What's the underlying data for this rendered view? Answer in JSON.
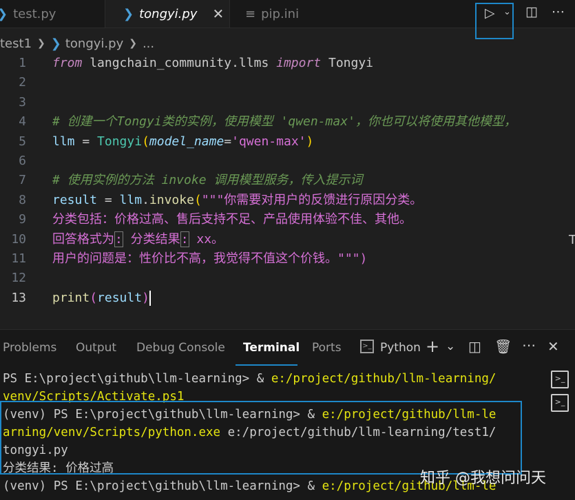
{
  "tabs": [
    {
      "label": "test.py",
      "active": false
    },
    {
      "label": "tongyi.py",
      "active": true
    },
    {
      "label": "pip.ini",
      "active": false
    }
  ],
  "tab_close_glyph": "✕",
  "breadcrumb": {
    "folder": "test1",
    "file": "tongyi.py",
    "more": "..."
  },
  "line_numbers": [
    "1",
    "2",
    "3",
    "4",
    "5",
    "6",
    "7",
    "8",
    "9",
    "10",
    "11",
    "12",
    "13"
  ],
  "code": {
    "l1": {
      "kw_from": "from",
      "module": " langchain_community.llms ",
      "kw_import": "import",
      "cls": " Tongyi"
    },
    "l4": "# 创建一个Tongyi类的实例，使用模型 'qwen-max'，你也可以将使用其他模型，",
    "l5": {
      "var": "llm",
      "eq": " = ",
      "cls": "Tongyi",
      "open": "(",
      "param": "model_name",
      "assign": "=",
      "str": "'qwen-max'",
      "close": ")"
    },
    "l7": "# 使用实例的方法 invoke 调用模型服务，传入提示词",
    "l8": {
      "var": "result",
      "eq": " = ",
      "obj": "llm",
      "dot": ".",
      "fn": "invoke",
      "open": "(",
      "str": "\"\"\"你需要对用户的反馈进行原因分类。"
    },
    "l9": "分类包括：价格过高、售后支持不足、产品使用体验不佳、其他。",
    "l10": {
      "a": "回答格式为",
      "c1": ":",
      "b": " 分类结果",
      "c2": ":",
      "c": " xx。"
    },
    "l11": "用户的问题是：性价比不高，我觉得不值这个价钱。\"\"\")",
    "l13": {
      "fn": "print",
      "open": "(",
      "arg": "result",
      "close": ")"
    }
  },
  "panel": {
    "tabs": [
      "Problems",
      "Output",
      "Debug Console",
      "Terminal",
      "Ports"
    ],
    "active_tab": "Terminal",
    "terminal_profile": "Python"
  },
  "terminal": {
    "l1a": "PS E:\\project\\github\\llm-learning> & ",
    "l1b": "e:/project/github/llm-learning/",
    "l2": "venv/Scripts/Activate.ps1",
    "l3a": "(venv) PS E:\\project\\github\\llm-learning> & ",
    "l3b": "e:/project/github/llm-le",
    "l4a": "arning/venv/Scripts/python.exe",
    "l4b": " e:/project/github/llm-learning/test1/",
    "l5": "tongyi.py",
    "l6": "分类结果: 价格过高",
    "l7a": "(venv) PS E:\\project\\github\\llm-learning> & ",
    "l7b": "e:/project/github/llm-le"
  },
  "watermark": "知乎 @我想问问天",
  "colors": {
    "accent": "#1e88c9",
    "keyword": "#c586c0",
    "string": "#d670d6",
    "comment": "#6a9955",
    "class": "#4ec9b0",
    "variable": "#9cdcfe",
    "terminal_path": "#e5e510"
  }
}
